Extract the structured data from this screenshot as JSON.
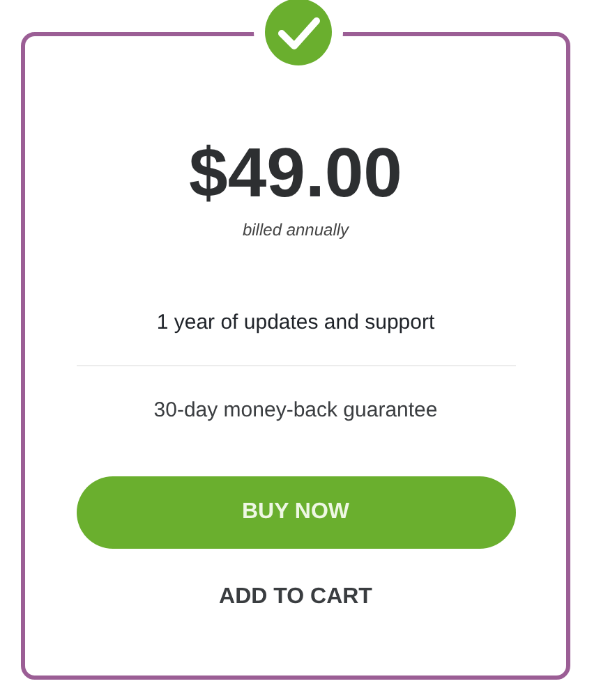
{
  "price": "$49.00",
  "billing": "billed annually",
  "features": [
    "1 year of updates and support",
    "30-day money-back guarantee"
  ],
  "buttons": [
    {
      "kind": "primary",
      "label": "BUY NOW"
    },
    {
      "kind": "link",
      "label": "ADD TO CART"
    }
  ]
}
